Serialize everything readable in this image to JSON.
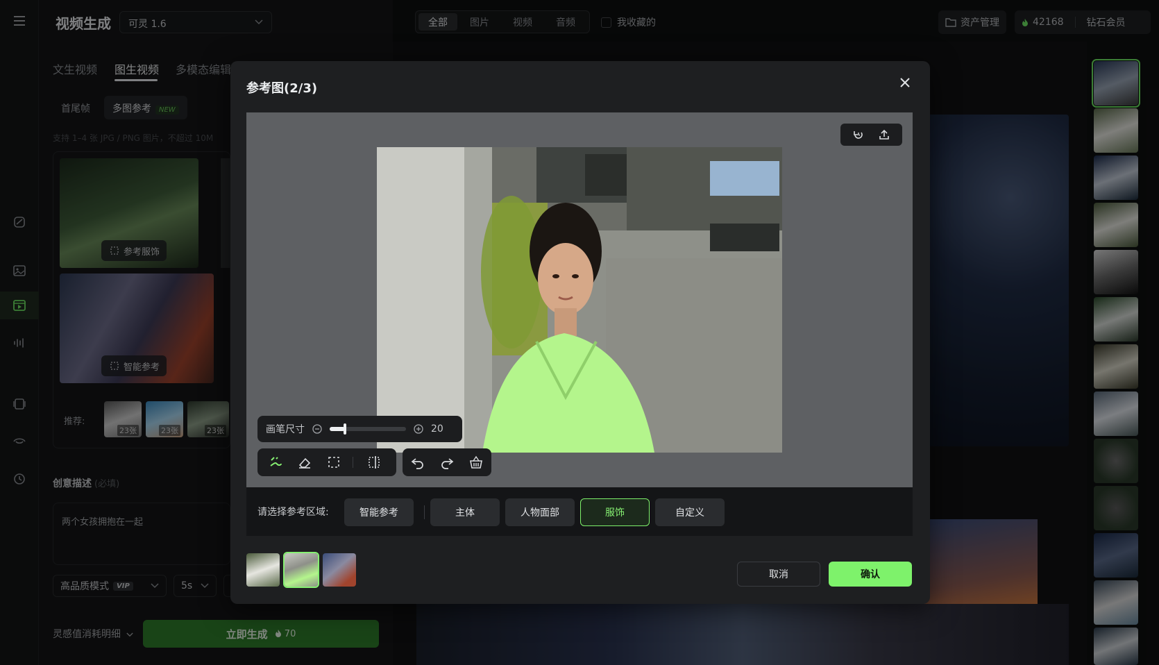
{
  "app": {
    "title": "视频生成",
    "model": "可灵 1.6"
  },
  "left": {
    "tabs": [
      {
        "label": "文生视频"
      },
      {
        "label": "图生视频"
      },
      {
        "label": "多模态编辑"
      }
    ],
    "subtabs": [
      {
        "label": "首尾帧"
      },
      {
        "label": "多图参考",
        "tag": "NEW"
      }
    ],
    "hint": "支持 1–4 张 JPG / PNG 图片，不超过 10M",
    "chips": {
      "outfit": "参考服饰",
      "smart": "智能参考"
    },
    "recommend_label": "推荐:",
    "recommend": [
      {
        "count": "23张"
      },
      {
        "count": "23张"
      },
      {
        "count": "23张"
      }
    ],
    "desc_title": "创意描述",
    "desc_required": "(必填)",
    "desc_text": "两个女孩拥抱在一起",
    "quality": "高品质模式",
    "vip": "VIP",
    "duration": "5s",
    "cost_detail": "灵感值消耗明细",
    "generate": "立即生成",
    "generate_cost": "70"
  },
  "top": {
    "filters": [
      "全部",
      "图片",
      "视频",
      "音频"
    ],
    "favorites": "我收藏的",
    "assets": "资产管理",
    "credits": "42168",
    "membership": "钻石会员"
  },
  "modal": {
    "title": "参考图(2/3)",
    "brush_label": "画笔尺寸",
    "brush_value": "20",
    "brush_level": 0.2,
    "region_label": "请选择参考区域:",
    "regions": [
      {
        "label": "智能参考"
      },
      {
        "label": "主体"
      },
      {
        "label": "人物面部"
      },
      {
        "label": "服饰",
        "selected": true
      },
      {
        "label": "自定义"
      }
    ],
    "cancel": "取消",
    "confirm": "确认"
  },
  "colors": {
    "accent": "#7ef26b",
    "generate_bg": "#2f7d2a",
    "highlight": "#b4f58c"
  }
}
